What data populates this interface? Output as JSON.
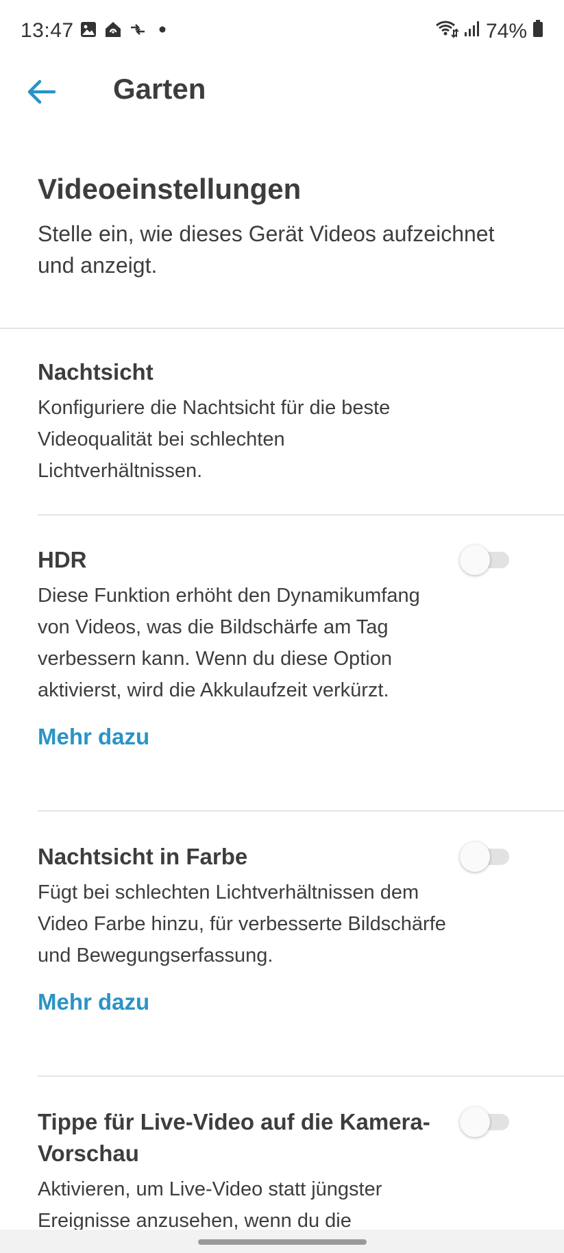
{
  "status_bar": {
    "time": "13:47",
    "battery": "74%",
    "left_icons": [
      "gallery-icon",
      "home-app-icon",
      "data-transfer-icon",
      "dot-icon"
    ],
    "right_icons": [
      "wifi-icon",
      "signal-icon",
      "battery-icon"
    ]
  },
  "app_bar": {
    "title": "Garten",
    "back_icon": "arrow-left-icon",
    "accent_color": "#2a93c6"
  },
  "header": {
    "title": "Videoeinstellungen",
    "subtitle": "Stelle ein, wie dieses Gerät Videos aufzeichnet und anzeigt."
  },
  "settings": {
    "night_vision": {
      "title": "Nachtsicht",
      "description": "Konfiguriere die Nachtsicht für die beste Videoqualität bei schlechten Lichtverhältnissen."
    },
    "hdr": {
      "title": "HDR",
      "description": "Diese Funktion erhöht den Dynamikumfang von Videos, was die Bildschärfe am Tag verbessern kann. Wenn du diese Option aktivierst, wird die Akkulaufzeit verkürzt.",
      "link": "Mehr dazu",
      "enabled": false
    },
    "color_night_vision": {
      "title": "Nachtsicht in Farbe",
      "description": "Fügt bei schlechten Lichtverhältnissen dem Video Farbe hinzu, für verbesserte Bildschärfe und Bewegungserfassung.",
      "link": "Mehr dazu",
      "enabled": false
    },
    "tap_live_video": {
      "title": "Tippe für Live-Video auf die Kamera-Vorschau",
      "description": "Aktivieren, um Live-Video statt jüngster Ereignisse anzusehen, wenn du die",
      "enabled": false
    }
  }
}
